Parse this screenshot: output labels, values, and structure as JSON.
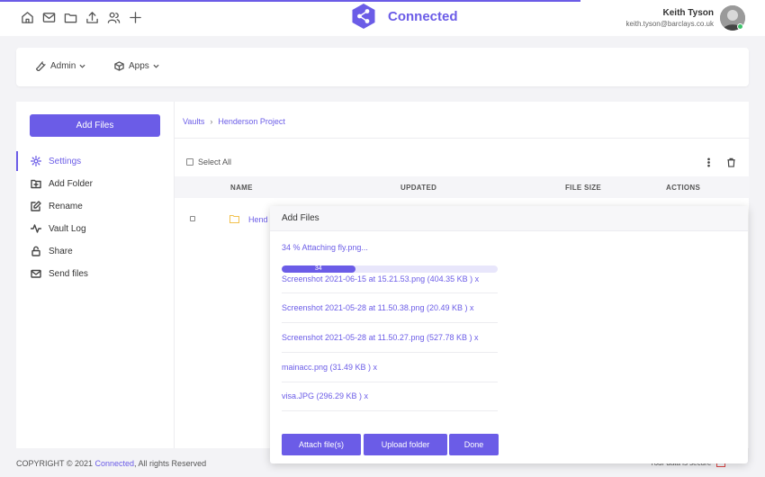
{
  "header": {
    "app_name": "Connected",
    "user_name": "Keith Tyson",
    "user_email": "keith.tyson@barclays.co.uk",
    "top_icons": [
      "home-icon",
      "mail-icon",
      "folder-icon",
      "upload-icon",
      "users-icon",
      "plus-icon"
    ]
  },
  "menubar": {
    "admin_label": "Admin",
    "apps_label": "Apps"
  },
  "sidebar": {
    "add_files_label": "Add Files",
    "items": [
      {
        "label": "Settings",
        "icon": "gear-icon",
        "active": true
      },
      {
        "label": "Add Folder",
        "icon": "folder-plus-icon"
      },
      {
        "label": "Rename",
        "icon": "edit-icon"
      },
      {
        "label": "Vault Log",
        "icon": "activity-icon"
      },
      {
        "label": "Share",
        "icon": "lock-icon"
      },
      {
        "label": "Send files",
        "icon": "mail-icon"
      }
    ]
  },
  "main": {
    "breadcrumb": [
      "Vaults",
      "Henderson Project"
    ],
    "select_all_label": "Select All",
    "columns": [
      "NAME",
      "UPDATED",
      "FILE SIZE",
      "ACTIONS"
    ],
    "rows": [
      {
        "name": "Hend"
      }
    ]
  },
  "dialog": {
    "title": "Add Files",
    "status": "34 % Attaching fly.png...",
    "progress_percent": 34,
    "progress_label": "34",
    "files": [
      "Screenshot 2021-06-15 at 15.21.53.png (404.35 KB ) x",
      "Screenshot 2021-05-28 at 11.50.38.png (20.49 KB ) x",
      "Screenshot 2021-05-28 at 11.50.27.png (527.78 KB ) x",
      "mainacc.png (31.49 KB ) x",
      "visa.JPG (296.29 KB ) x"
    ],
    "attach_label": "Attach file(s)",
    "upload_folder_label": "Upload folder",
    "done_label": "Done"
  },
  "footer": {
    "prefix": "COPYRIGHT © 2021 ",
    "link": "Connected",
    "suffix": ", All rights Reserved",
    "right_text": "Your data is secure"
  },
  "colors": {
    "accent": "#6b5ce7",
    "background": "#f3f3f6",
    "online": "#3cc36b"
  }
}
